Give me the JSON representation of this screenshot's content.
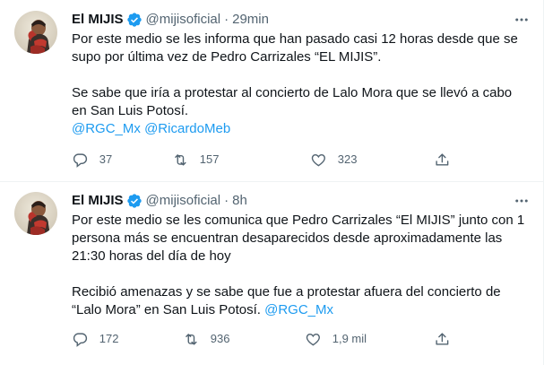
{
  "tweets": [
    {
      "author": {
        "name": "El MIJIS",
        "handle": "@mijisoficial",
        "separator": "·",
        "time": "29min",
        "verified": true
      },
      "body": {
        "line1": "Por este medio se les informa que han pasado casi 12 horas desde que se",
        "line2": "supo por última vez de Pedro Carrizales “EL MIJIS”.",
        "line3": "Se sabe que iría a protestar al concierto de Lalo Mora que se llevó a cabo",
        "line4": "en San Luis Potosí.",
        "mention1": "@RGC_Mx",
        "mention2": "@RicardoMeb"
      },
      "actions": {
        "replies": "37",
        "retweets": "157",
        "likes": "323"
      }
    },
    {
      "author": {
        "name": "El MIJIS",
        "handle": "@mijisoficial",
        "separator": "·",
        "time": "8h",
        "verified": true
      },
      "body": {
        "line1": "Por este medio se les comunica que Pedro Carrizales “El MIJIS” junto con 1",
        "line2": "persona más se encuentran desaparecidos desde aproximadamente las",
        "line3": "21:30 horas del día de hoy",
        "line4": "Recibió amenazas y se sabe que fue a protestar afuera del concierto de",
        "line5": "“Lalo Mora” en San Luis Potosí.",
        "mention1": "@RGC_Mx"
      },
      "actions": {
        "replies": "172",
        "retweets": "936",
        "likes": "1,9 mil"
      }
    }
  ],
  "icons": {
    "verified": "verified-badge-icon",
    "more": "more-dots-icon",
    "reply": "reply-icon",
    "retweet": "retweet-icon",
    "like": "like-icon",
    "share": "share-icon"
  },
  "colors": {
    "text": "#0f1419",
    "secondary": "#536471",
    "link": "#1d9bf0",
    "border": "#eff3f4"
  }
}
